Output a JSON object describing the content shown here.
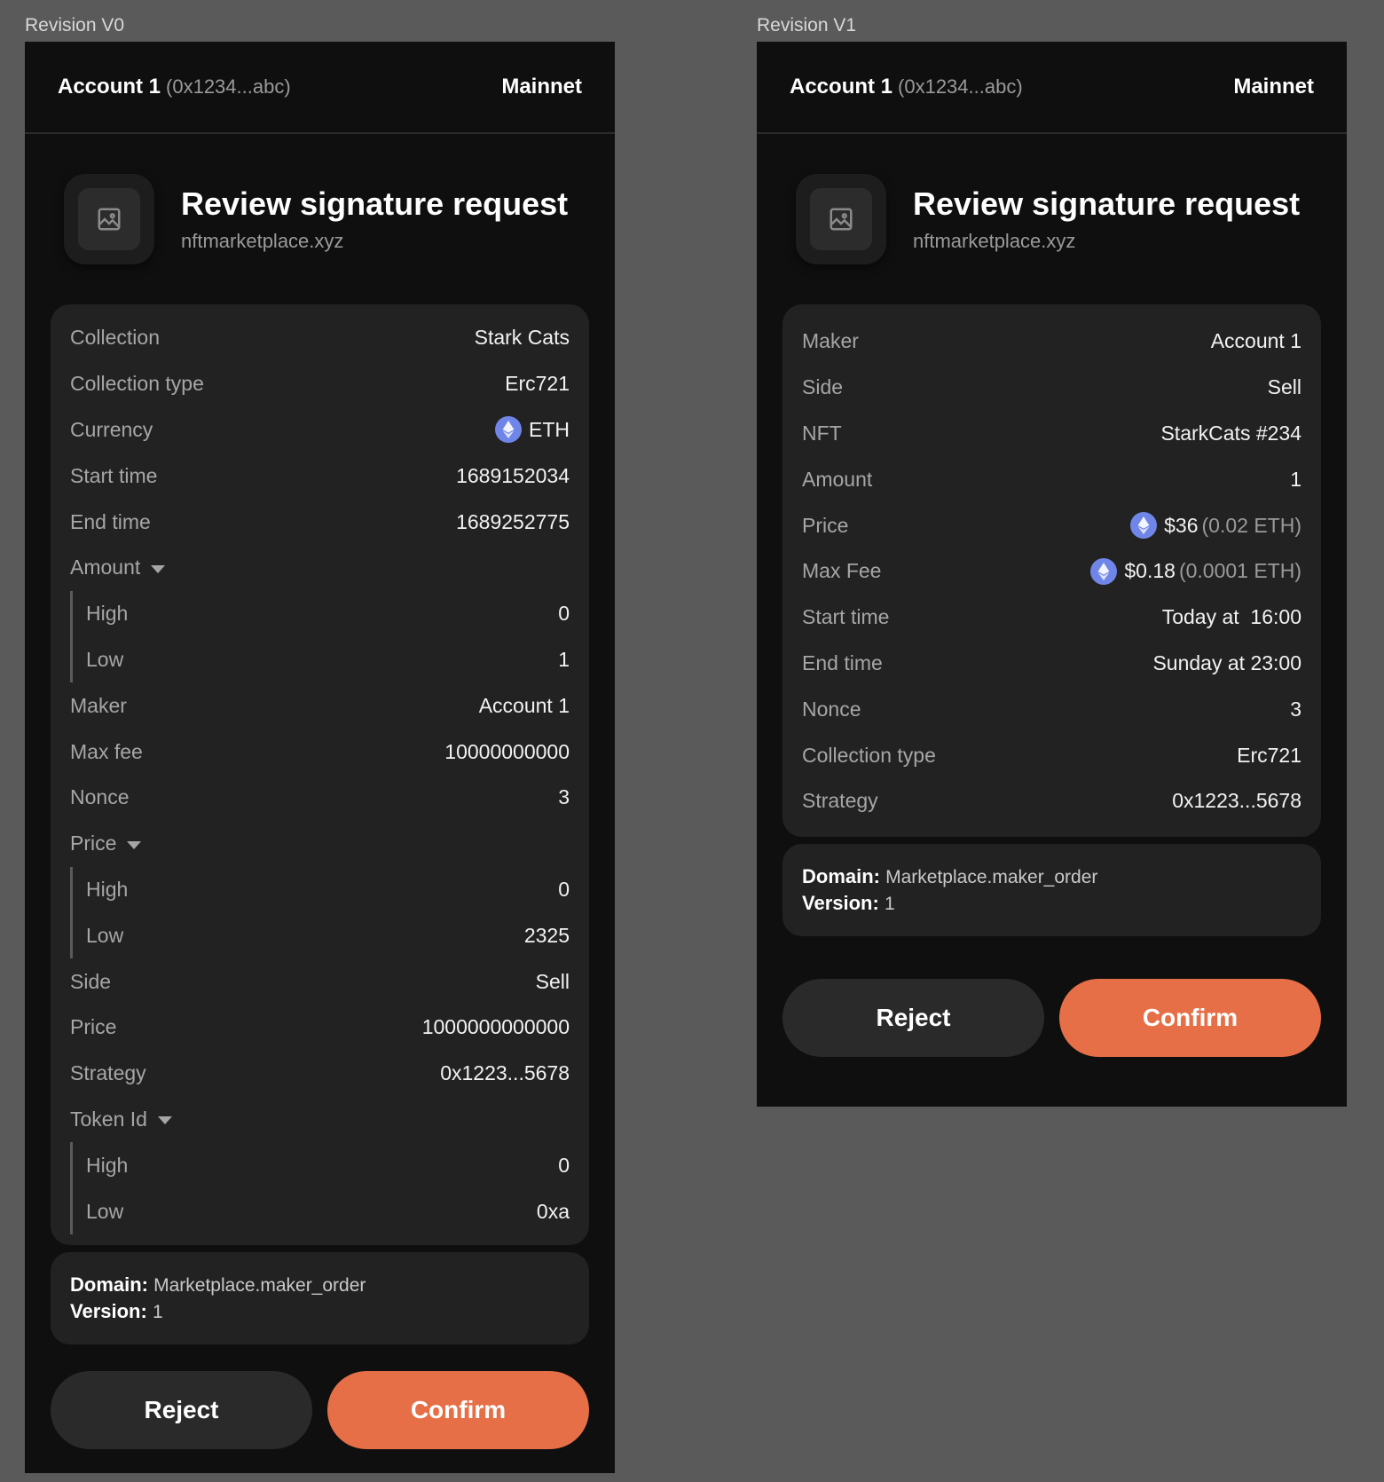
{
  "revisions": [
    {
      "label": "Revision V0",
      "account_name": "Account 1",
      "account_address": "(0x1234...abc)",
      "network": "Mainnet",
      "title": "Review signature request",
      "origin": "nftmarketplace.xyz",
      "rows": {
        "collection": {
          "key": "Collection",
          "value": "Stark Cats"
        },
        "collection_type": {
          "key": "Collection type",
          "value": "Erc721"
        },
        "currency": {
          "key": "Currency",
          "value": "ETH"
        },
        "start_time": {
          "key": "Start time",
          "value": "1689152034"
        },
        "end_time": {
          "key": "End time",
          "value": "1689252775"
        },
        "amount": {
          "key": "Amount",
          "high_key": "High",
          "high": "0",
          "low_key": "Low",
          "low": "1"
        },
        "maker": {
          "key": "Maker",
          "value": "Account 1"
        },
        "max_fee": {
          "key": "Max fee",
          "value": "10000000000"
        },
        "nonce": {
          "key": "Nonce",
          "value": "3"
        },
        "price_group": {
          "key": "Price",
          "high_key": "High",
          "high": "0",
          "low_key": "Low",
          "low": "2325"
        },
        "side": {
          "key": "Side",
          "value": "Sell"
        },
        "price": {
          "key": "Price",
          "value": "1000000000000"
        },
        "strategy": {
          "key": "Strategy",
          "value": "0x1223...5678"
        },
        "token_id": {
          "key": "Token Id",
          "high_key": "High",
          "high": "0",
          "low_key": "Low",
          "low": "0xa"
        }
      },
      "domain_label": "Domain:",
      "domain_value": "Marketplace.maker_order",
      "version_label": "Version:",
      "version_value": "1",
      "reject": "Reject",
      "confirm": "Confirm"
    },
    {
      "label": "Revision V1",
      "account_name": "Account 1",
      "account_address": "(0x1234...abc)",
      "network": "Mainnet",
      "title": "Review signature request",
      "origin": "nftmarketplace.xyz",
      "rows": {
        "maker": {
          "key": "Maker",
          "value": "Account 1"
        },
        "side": {
          "key": "Side",
          "value": "Sell"
        },
        "nft": {
          "key": "NFT",
          "value": "StarkCats #234"
        },
        "amount": {
          "key": "Amount",
          "value": "1"
        },
        "price": {
          "key": "Price",
          "value": "$36",
          "sub": "(0.02 ETH)"
        },
        "max_fee": {
          "key": "Max Fee",
          "value": "$0.18",
          "sub": "(0.0001 ETH)"
        },
        "start_time": {
          "key": "Start time",
          "value": "Today at  16:00"
        },
        "end_time": {
          "key": "End time",
          "value": "Sunday at 23:00"
        },
        "nonce": {
          "key": "Nonce",
          "value": "3"
        },
        "collection_type": {
          "key": "Collection type",
          "value": "Erc721"
        },
        "strategy": {
          "key": "Strategy",
          "value": "0x1223...5678"
        }
      },
      "domain_label": "Domain:",
      "domain_value": "Marketplace.maker_order",
      "version_label": "Version:",
      "version_value": "1",
      "reject": "Reject",
      "confirm": "Confirm"
    }
  ],
  "colors": {
    "background": "#5a5a5a",
    "panel": "#0f0f10",
    "card": "#222223",
    "confirm": "#e66f47",
    "eth": "#6f86e8"
  },
  "icons": {
    "app": "image-placeholder-icon",
    "currency": "ethereum-icon",
    "expand": "caret-down-icon"
  }
}
